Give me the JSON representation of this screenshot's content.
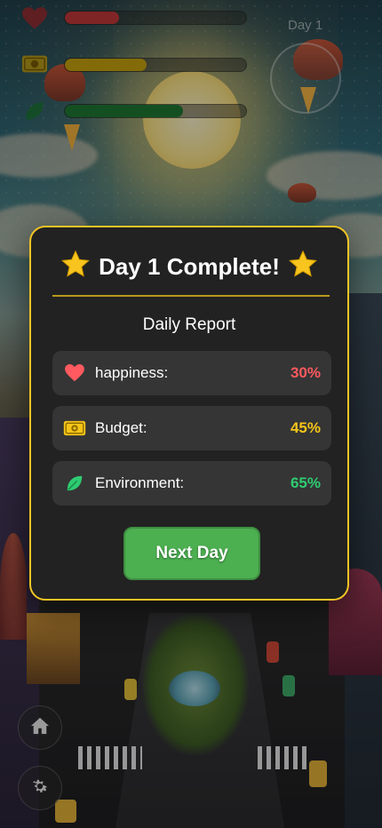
{
  "hud": {
    "day_label": "Day 1",
    "stats": [
      {
        "name": "happiness",
        "icon": "heart-icon",
        "fraction": 0.3,
        "color": "#c53a3a"
      },
      {
        "name": "budget",
        "icon": "money-icon",
        "fraction": 0.45,
        "color": "#c9a50f"
      },
      {
        "name": "environment",
        "icon": "leaf-icon",
        "fraction": 0.65,
        "color": "#1f7a35"
      }
    ]
  },
  "modal": {
    "title": "Day 1 Complete!",
    "subtitle": "Daily Report",
    "stats": [
      {
        "label": "happiness:",
        "value": "30%",
        "icon": "heart-icon",
        "color": "#ff5a5f"
      },
      {
        "label": "Budget:",
        "value": "45%",
        "icon": "money-icon",
        "color": "#f5c518"
      },
      {
        "label": "Environment:",
        "value": "65%",
        "icon": "leaf-icon",
        "color": "#2ecc71"
      }
    ],
    "button_label": "Next Day"
  },
  "side_buttons": [
    "home-icon",
    "gear-icon"
  ]
}
